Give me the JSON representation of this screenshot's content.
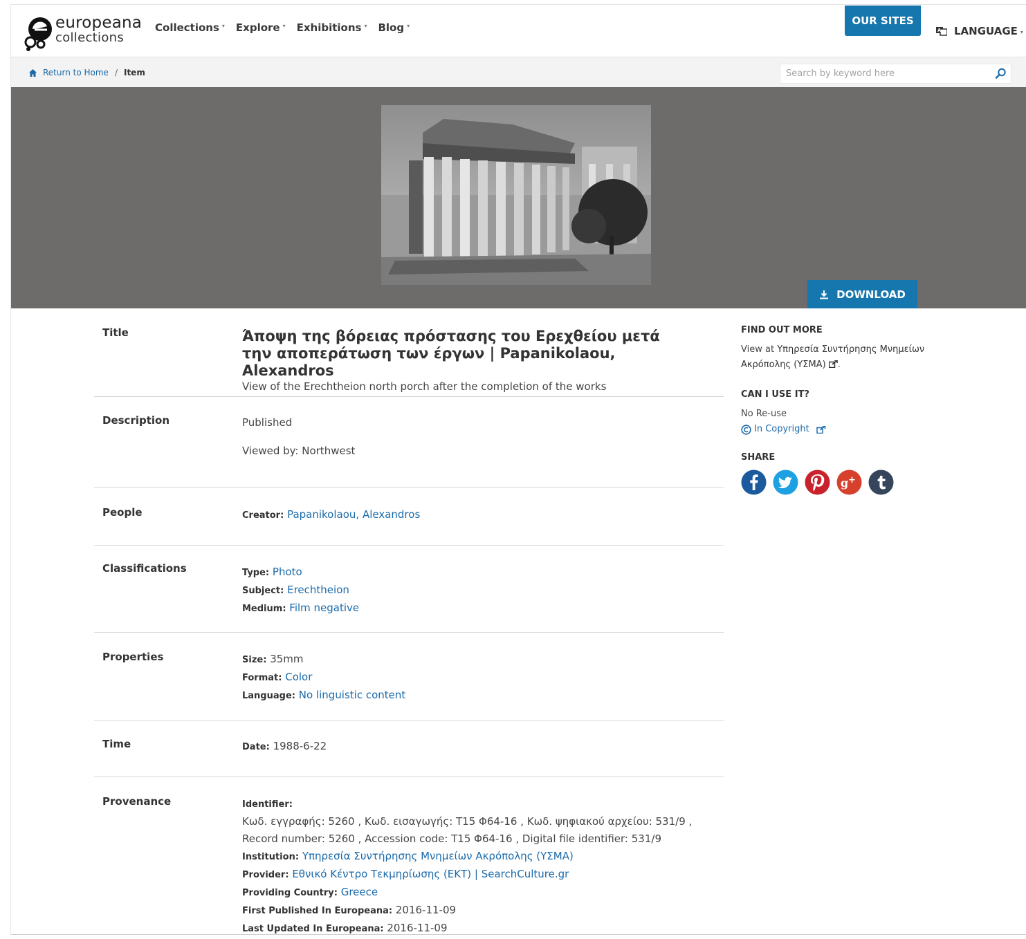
{
  "header": {
    "logo_word1": "europeana",
    "logo_word2": "collections",
    "nav": [
      {
        "label": "Collections"
      },
      {
        "label": "Explore"
      },
      {
        "label": "Exhibitions"
      },
      {
        "label": "Blog"
      }
    ],
    "our_sites": "OUR SITES",
    "language": "LANGUAGE"
  },
  "breadcrumb": {
    "home": "Return to Home",
    "separator": "/",
    "current": "Item"
  },
  "search": {
    "placeholder": "Search by keyword here"
  },
  "hero": {
    "download": "DOWNLOAD"
  },
  "metadata": {
    "title": {
      "label": "Title",
      "value": "Άποψη της βόρειας πρόστασης του Ερεχθείου μετά την αποπεράτωση των έργων | Papanikolaou, Alexandros",
      "subtitle": "View of the Erechtheion north porch after the completion of the works"
    },
    "description": {
      "label": "Description",
      "line1": "Published",
      "line2": "Viewed by: Northwest"
    },
    "people": {
      "label": "People",
      "creator_key": "Creator:",
      "creator_value": "Papanikolaou, Alexandros"
    },
    "classifications": {
      "label": "Classifications",
      "type_key": "Type:",
      "type_value": "Photo",
      "subject_key": "Subject:",
      "subject_value": "Erechtheion",
      "medium_key": "Medium:",
      "medium_value": "Film negative"
    },
    "properties": {
      "label": "Properties",
      "size_key": "Size:",
      "size_value": "35mm",
      "format_key": "Format:",
      "format_value": "Color",
      "language_key": "Language:",
      "language_value": "No linguistic content"
    },
    "time": {
      "label": "Time",
      "date_key": "Date:",
      "date_value": "1988-6-22"
    },
    "provenance": {
      "label": "Provenance",
      "identifier_key": "Identifier:",
      "identifier_line1": "Κωδ. εγγραφής: 5260 ,  Κωδ. εισαγωγής: T15 Φ64-16 ,  Κωδ. ψηφιακού αρχείου: 531/9 ,",
      "identifier_line2": "Record number: 5260 ,  Accession code: T15 Φ64-16 ,  Digital file identifier: 531/9",
      "institution_key": "Institution:",
      "institution_value": "Υπηρεσία Συντήρησης Μνημείων Ακρόπολης (ΥΣΜΑ)",
      "provider_key": "Provider:",
      "provider_value": "Εθνικό Κέντρο Τεκμηρίωσης (ΕΚΤ) | SearchCulture.gr",
      "country_key": "Providing Country:",
      "country_value": "Greece",
      "first_key": "First Published In Europeana:",
      "first_value": "2016-11-09",
      "last_key": "Last Updated In Europeana:",
      "last_value": "2016-11-09"
    }
  },
  "sidebar": {
    "find_out_more": "FIND OUT MORE",
    "view_at_prefix": "View at ",
    "view_at_link": "Υπηρεσία Συντήρησης Μνημείων Ακρόπολης (ΥΣΜΑ)",
    "view_at_suffix": ".",
    "can_i_use": "CAN I USE IT?",
    "reuse": "No Re-use",
    "rights": "In Copyright",
    "share": "SHARE",
    "share_icons": [
      "facebook-icon",
      "twitter-icon",
      "pinterest-icon",
      "google-plus-icon",
      "tumblr-icon"
    ]
  },
  "colors": {
    "accent": "#1676ae",
    "link": "#1a6aaa",
    "hero_bg": "#6e6b6b",
    "facebook": "#1b5a9c",
    "twitter": "#1da1e2",
    "pinterest": "#c8232c",
    "google_plus": "#d6402d",
    "tumblr": "#35465c"
  }
}
